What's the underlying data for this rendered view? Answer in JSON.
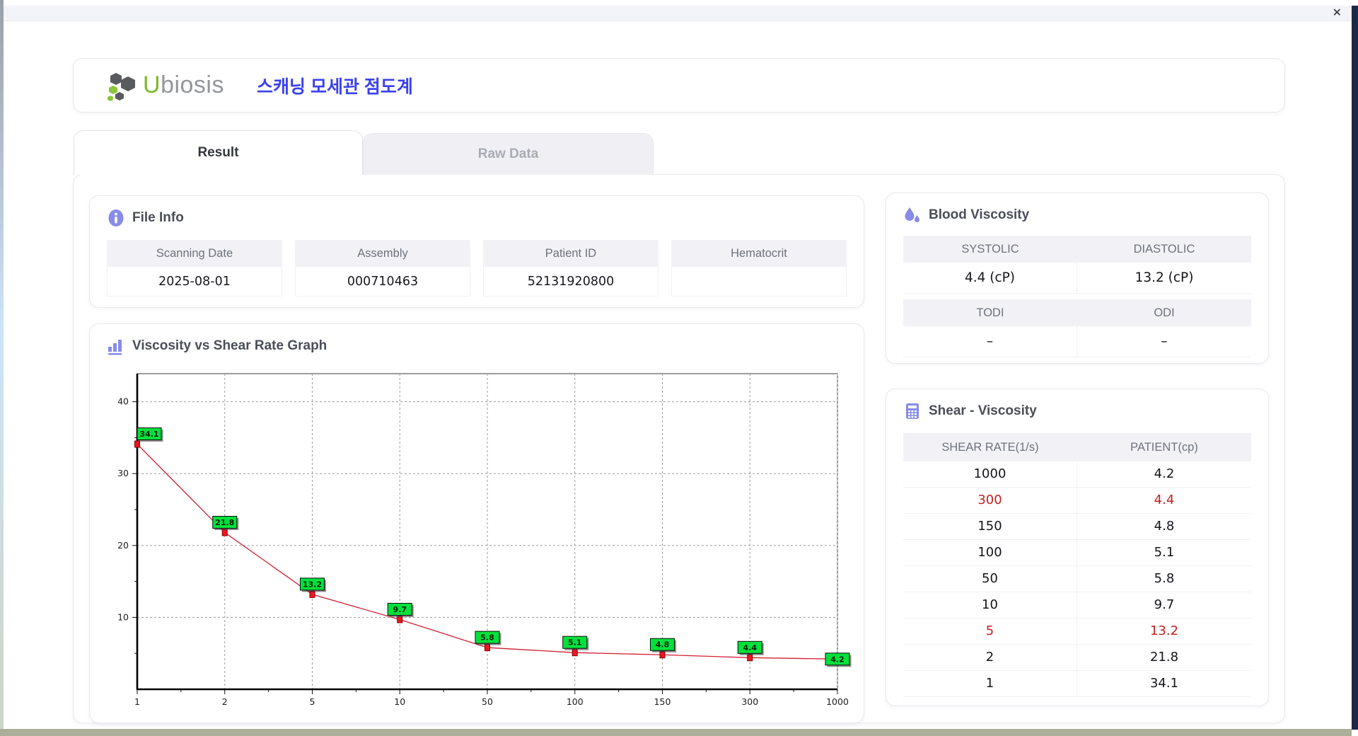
{
  "window": {
    "close_glyph": "✕"
  },
  "header": {
    "logo_u": "U",
    "logo_rest": "biosis",
    "title_ko": "스캐닝 모세관 점도계"
  },
  "tabs": [
    {
      "label": "Result",
      "active": true
    },
    {
      "label": "Raw Data",
      "active": false
    }
  ],
  "file_info": {
    "title": "File Info",
    "fields": [
      {
        "label": "Scanning Date",
        "value": "2025-08-01"
      },
      {
        "label": "Assembly",
        "value": "000710463"
      },
      {
        "label": "Patient ID",
        "value": "52131920800"
      },
      {
        "label": "Hematocrit",
        "value": ""
      }
    ]
  },
  "blood_viscosity": {
    "title": "Blood Viscosity",
    "cells": [
      {
        "label": "SYSTOLIC",
        "value": "4.4 (cP)"
      },
      {
        "label": "DIASTOLIC",
        "value": "13.2 (cP)"
      },
      {
        "label": "TODI",
        "value": "–"
      },
      {
        "label": "ODI",
        "value": "–"
      }
    ]
  },
  "shear_viscosity": {
    "title": "Shear - Viscosity",
    "columns": [
      "SHEAR RATE(1/s)",
      "PATIENT(cp)"
    ],
    "rows": [
      {
        "shear": "1000",
        "patient": "4.2",
        "highlight": false
      },
      {
        "shear": "300",
        "patient": "4.4",
        "highlight": true
      },
      {
        "shear": "150",
        "patient": "4.8",
        "highlight": false
      },
      {
        "shear": "100",
        "patient": "5.1",
        "highlight": false
      },
      {
        "shear": "50",
        "patient": "5.8",
        "highlight": false
      },
      {
        "shear": "10",
        "patient": "9.7",
        "highlight": false
      },
      {
        "shear": "5",
        "patient": "13.2",
        "highlight": true
      },
      {
        "shear": "2",
        "patient": "21.8",
        "highlight": false
      },
      {
        "shear": "1",
        "patient": "34.1",
        "highlight": false
      }
    ]
  },
  "chart_data": {
    "type": "line",
    "title": "Viscosity vs Shear Rate Graph",
    "x_categories": [
      "1",
      "2",
      "5",
      "10",
      "50",
      "100",
      "150",
      "300",
      "1000"
    ],
    "values": [
      34.1,
      21.8,
      13.2,
      9.7,
      5.8,
      5.1,
      4.8,
      4.4,
      4.2
    ],
    "point_labels": [
      "34.1",
      "21.8",
      "13.2",
      "9.7",
      "5.8",
      "5.1",
      "4.8",
      "4.4",
      "4.2"
    ],
    "xlabel": "",
    "ylabel": "",
    "ylim": [
      0,
      43.9
    ],
    "yticks": [
      10,
      20,
      30,
      40
    ],
    "grid": true,
    "legend": "none"
  },
  "colors": {
    "accent_purple": "#878ce8",
    "title_blue": "#3a41ee",
    "logo_green": "#7cb92c",
    "logo_gray": "#93969b",
    "highlight_red": "#c32020",
    "line_red": "#cf2030",
    "marker_red": "#ee1522",
    "marker_stroke": "#8b0000",
    "label_green": "#00e13c",
    "grid_gray": "#9a9a9a",
    "header_cell_bg": "#f2f2f6"
  }
}
